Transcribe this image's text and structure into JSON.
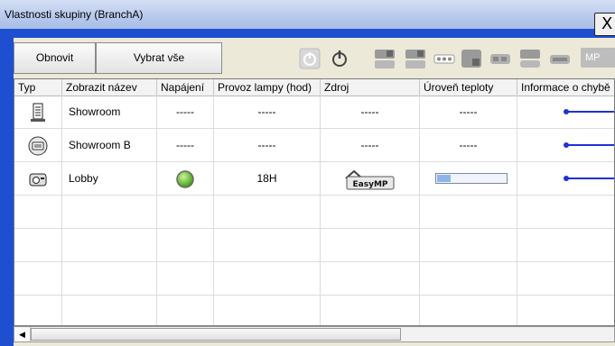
{
  "window": {
    "title": "Vlastnosti skupiny (BranchA)",
    "close_label": "X"
  },
  "toolbar": {
    "refresh_label": "Obnovit",
    "select_all_label": "Vybrat vše",
    "icons": [
      "power-on-icon",
      "power-off-icon",
      "input-computer1-icon",
      "input-computer2-icon",
      "input-video-icon",
      "input-svideo-icon",
      "input-component-icon",
      "input-hdmi-icon",
      "input-dvi-icon",
      "input-mp-icon"
    ],
    "mp_label": "MP"
  },
  "table": {
    "columns": [
      "Typ",
      "Zobrazit název",
      "Napájení",
      "Provoz lampy (hod)",
      "Zdroj",
      "Úroveň teploty",
      "Informace o chybě"
    ],
    "rows": [
      {
        "type_icon": "group-icon",
        "name": "Showroom",
        "power": "-----",
        "lamp": "-----",
        "source": "-----",
        "temp": "-----"
      },
      {
        "type_icon": "projector-group-icon",
        "name": "Showroom B",
        "power": "-----",
        "lamp": "-----",
        "source": "-----",
        "temp": "-----"
      },
      {
        "type_icon": "projector-icon",
        "name": "Lobby",
        "power": "",
        "lamp": "18H",
        "source": "EasyMP",
        "temp": ""
      }
    ],
    "temperature_level": 0.2
  },
  "colors": {
    "title_bar": "#b6c8ec",
    "accent_blue": "#1d32d6",
    "power_green": "#4caf1c"
  }
}
